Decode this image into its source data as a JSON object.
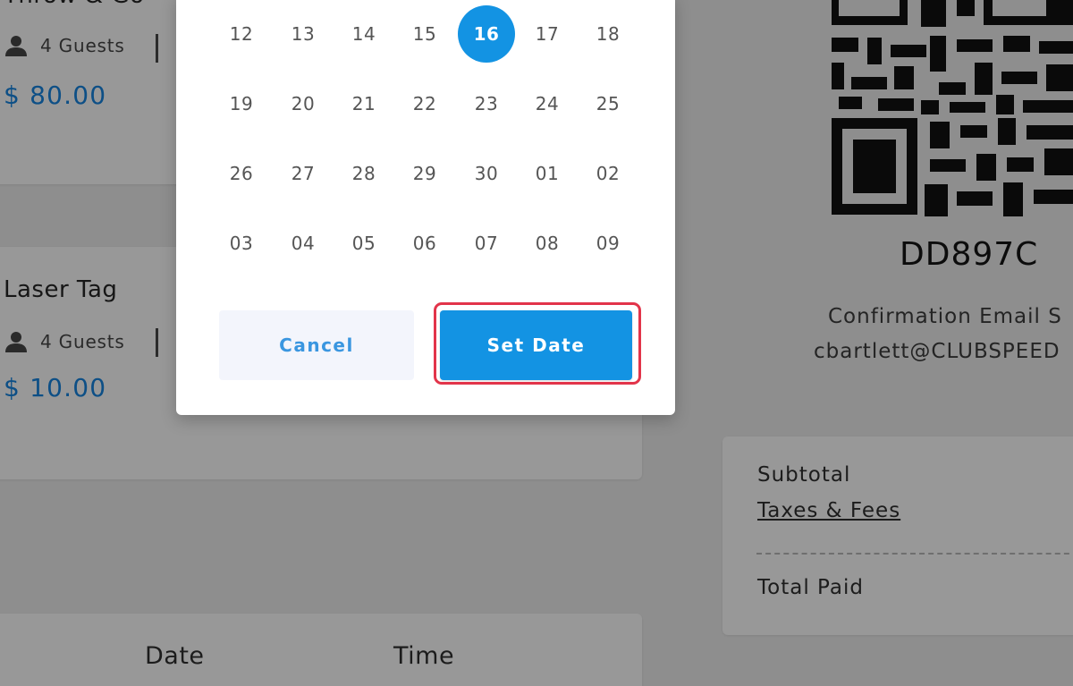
{
  "background": {
    "bookings": [
      {
        "title": "Throw & Go",
        "guests_label": "4 Guests",
        "price": "$ 80.00"
      },
      {
        "title": "Laser Tag",
        "guests_label": "4 Guests",
        "price": "$ 10.00"
      }
    ],
    "schedule_columns": {
      "date_label": "Date",
      "time_label": "Time"
    },
    "confirmation": {
      "code": "DD897C",
      "email_label": "Confirmation Email S",
      "email": "cbartlett@CLUBSPEED"
    },
    "summary": {
      "subtotal_label": "Subtotal",
      "taxes_label": "Taxes & Fees",
      "total_label": "Total Paid"
    }
  },
  "date_picker": {
    "rows": [
      [
        "12",
        "13",
        "14",
        "15",
        "16",
        "17",
        "18"
      ],
      [
        "19",
        "20",
        "21",
        "22",
        "23",
        "24",
        "25"
      ],
      [
        "26",
        "27",
        "28",
        "29",
        "30",
        "01",
        "02"
      ],
      [
        "03",
        "04",
        "05",
        "06",
        "07",
        "08",
        "09"
      ]
    ],
    "selected_day": "16",
    "cancel_label": "Cancel",
    "set_date_label": "Set Date"
  },
  "colors": {
    "accent": "#1393e3",
    "highlight_border": "#e2344a",
    "overlay": "#8e8e8e",
    "price_text": "#0d4f86"
  },
  "icons": {
    "guest": "person-icon"
  }
}
